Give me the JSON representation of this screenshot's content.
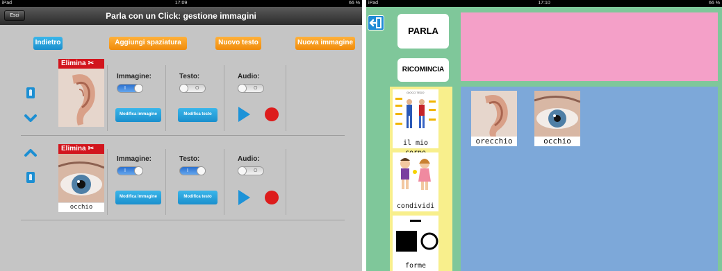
{
  "left_screen": {
    "status": {
      "device": "iPad",
      "time": "17:09",
      "battery": "66 %"
    },
    "title": "Parla con un Click: gestione immagini",
    "exit_label": "Esci",
    "toolbar": {
      "back_label": "Indietro",
      "add_space_label": "Aggiungi spaziatura",
      "new_text_label": "Nuovo testo",
      "new_image_label": "Nuova immagine"
    },
    "items": [
      {
        "delete_label": "Elimina",
        "caption": "",
        "image_label": "Immagine:",
        "text_label": "Testo:",
        "audio_label": "Audio:",
        "image_toggle": "I",
        "text_toggle": "O",
        "audio_toggle": "O",
        "edit_image_label": "Modifica immagine",
        "edit_text_label": "Modifica testo"
      },
      {
        "delete_label": "Elimina",
        "caption": "occhio",
        "image_label": "Immagine:",
        "text_label": "Testo:",
        "audio_label": "Audio:",
        "image_toggle": "I",
        "text_toggle": "I",
        "audio_toggle": "O",
        "edit_image_label": "Modifica immagine",
        "edit_text_label": "Modifica testo"
      }
    ]
  },
  "right_screen": {
    "status": {
      "device": "iPad",
      "time": "17:10",
      "battery": "66 %"
    },
    "speak_label": "PARLA",
    "restart_label": "RICOMINCIA",
    "palette": [
      {
        "caption": "il mio corpo",
        "header": "GIOCO TEDO"
      },
      {
        "caption": "condividi"
      },
      {
        "caption": "forme"
      }
    ],
    "sentence": [
      {
        "caption": "orecchio"
      },
      {
        "caption": "occhio"
      }
    ]
  },
  "colors": {
    "accent_blue": "#1f8bd6",
    "accent_orange": "#f08b0a",
    "delete_red": "#d2151d",
    "sentence_pink": "#f4a0c8",
    "board_blue": "#7da8d9",
    "background_green": "#7fc79a",
    "palette_yellow": "#f8ef8c"
  }
}
